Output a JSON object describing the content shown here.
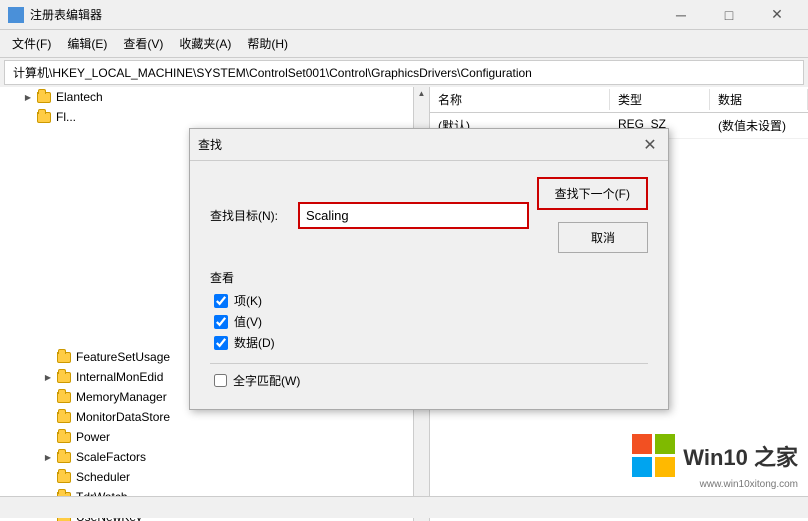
{
  "titleBar": {
    "icon": "🗂",
    "title": "注册表编辑器",
    "minimizeLabel": "─",
    "maximizeLabel": "□",
    "closeLabel": "✕"
  },
  "menuBar": {
    "items": [
      {
        "label": "文件(F)"
      },
      {
        "label": "编辑(E)"
      },
      {
        "label": "查看(V)"
      },
      {
        "label": "收藏夹(A)"
      },
      {
        "label": "帮助(H)"
      }
    ]
  },
  "breadcrumb": {
    "path": "计算机\\HKEY_LOCAL_MACHINE\\SYSTEM\\ControlSet001\\Control\\GraphicsDrivers\\Configuration"
  },
  "treePane": {
    "items": [
      {
        "label": "Elantech",
        "indent": 1,
        "expand": "▶",
        "hasArrow": true
      },
      {
        "label": "Fl...",
        "indent": 1,
        "expand": "",
        "hasArrow": false
      },
      {
        "label": "FeatureSetUsage",
        "indent": 2,
        "expand": "",
        "hasArrow": false
      },
      {
        "label": "InternalMonEdid",
        "indent": 2,
        "expand": "▶",
        "hasArrow": true
      },
      {
        "label": "MemoryManager",
        "indent": 2,
        "expand": "",
        "hasArrow": false
      },
      {
        "label": "MonitorDataStore",
        "indent": 2,
        "expand": "",
        "hasArrow": false
      },
      {
        "label": "Power",
        "indent": 2,
        "expand": "",
        "hasArrow": false
      },
      {
        "label": "ScaleFactors",
        "indent": 2,
        "expand": "▶",
        "hasArrow": true
      },
      {
        "label": "Scheduler",
        "indent": 2,
        "expand": "",
        "hasArrow": false
      },
      {
        "label": "TdrWatch",
        "indent": 2,
        "expand": "",
        "hasArrow": false
      },
      {
        "label": "UseNewKey",
        "indent": 2,
        "expand": "",
        "hasArrow": false
      }
    ]
  },
  "rightPane": {
    "columns": [
      "名称",
      "类型",
      "数据"
    ],
    "rows": [
      {
        "name": "(默认)",
        "type": "REG_SZ",
        "data": "(数值未设置)"
      }
    ]
  },
  "dialog": {
    "title": "查找",
    "closeBtn": "✕",
    "findTargetLabel": "查找目标(N):",
    "findValue": "Scaling",
    "findNextBtn": "查找下一个(F)",
    "cancelBtn": "取消",
    "lookInLabel": "查看",
    "checkboxes": [
      {
        "label": "项(K)",
        "checked": true
      },
      {
        "label": "值(V)",
        "checked": true
      },
      {
        "label": "数据(D)",
        "checked": true
      }
    ],
    "fullMatchLabel": "全字匹配(W)",
    "fullMatchChecked": false
  },
  "watermark": {
    "mainText": "Win10 之家",
    "url": "www.win10xitong.com"
  }
}
